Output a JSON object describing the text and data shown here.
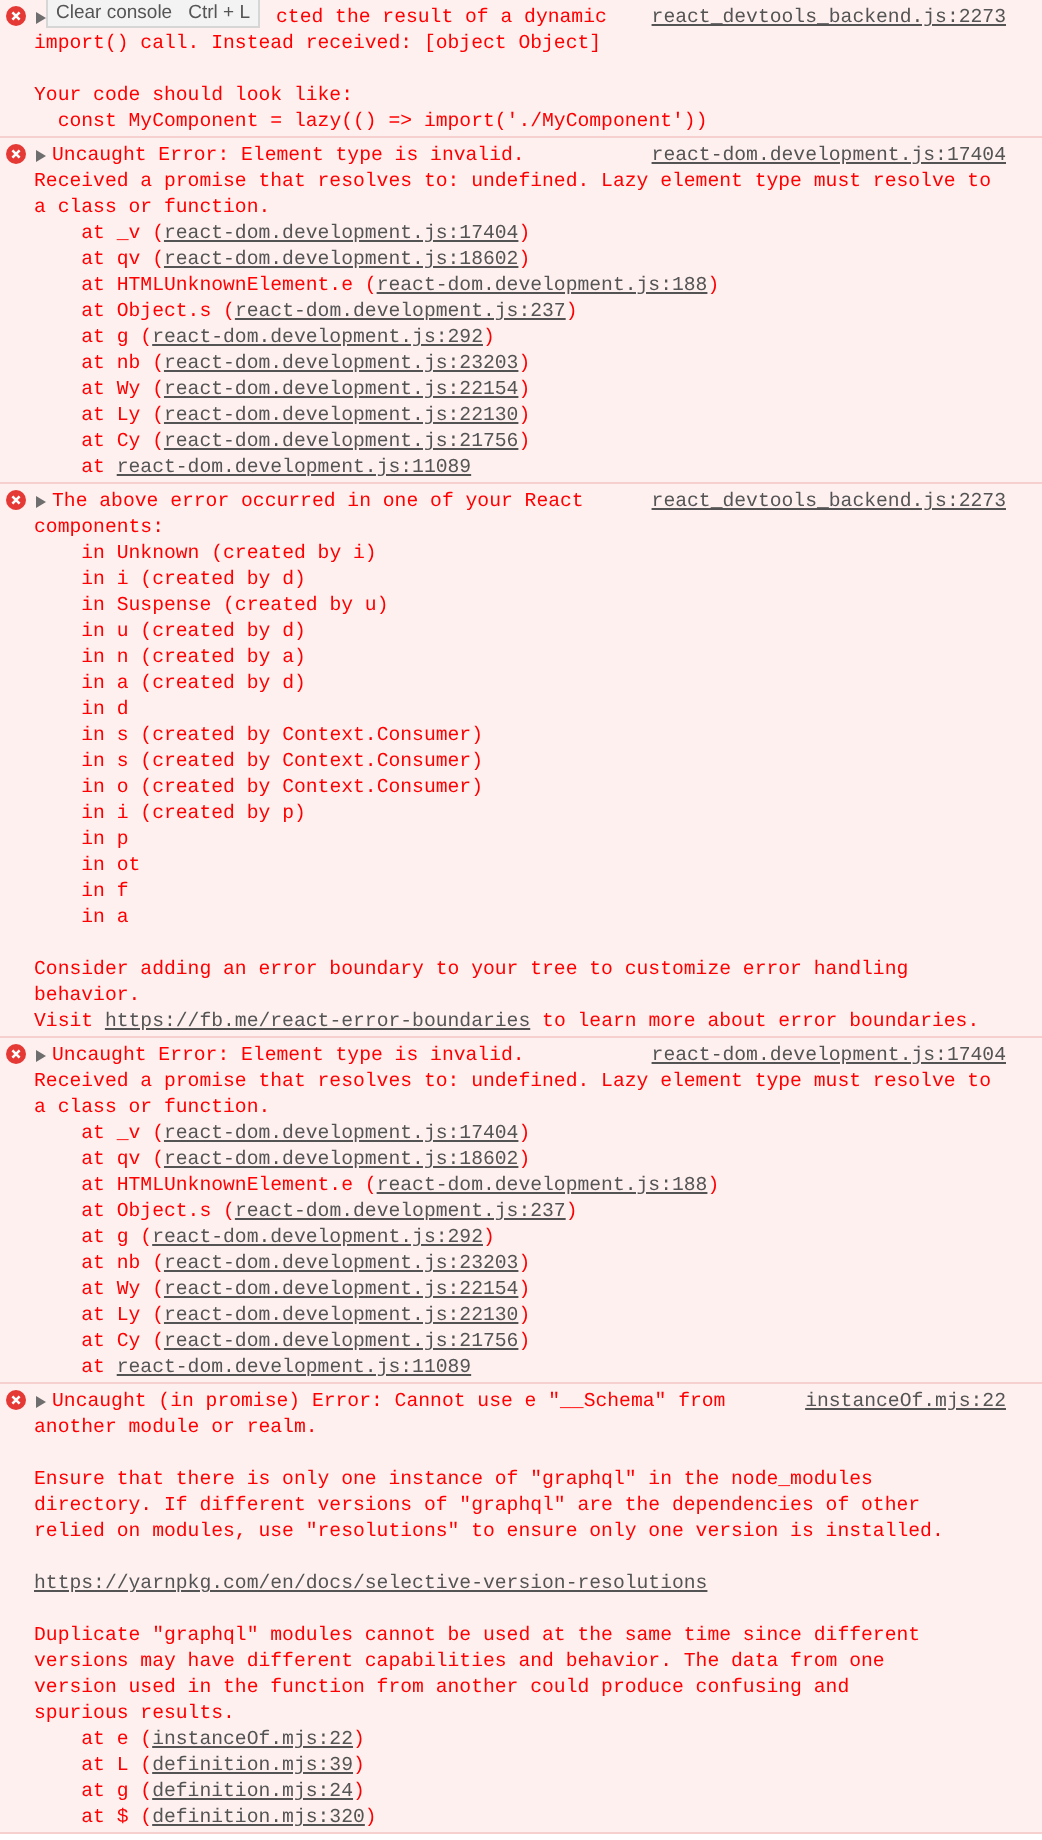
{
  "tooltip": {
    "label": "Clear console",
    "shortcut": "Ctrl + L"
  },
  "messages": [
    {
      "expanded": false,
      "header": "cted the result of a dynamic",
      "source": "react_devtools_backend.js:2273",
      "blocks": [
        {
          "kind": "text",
          "text": "import() call. Instead received: [object Object]\n\nYour code should look like:\n  const MyComponent = lazy(() => import('./MyComponent'))"
        }
      ]
    },
    {
      "expanded": false,
      "header": "Uncaught Error: Element type is invalid.",
      "source": "react-dom.development.js:17404",
      "blocks": [
        {
          "kind": "text",
          "text": "Received a promise that resolves to: undefined. Lazy element type must resolve to a class or function."
        },
        {
          "kind": "frame",
          "before": "    at _v (",
          "link": "react-dom.development.js:17404",
          "after": ")"
        },
        {
          "kind": "frame",
          "before": "    at qv (",
          "link": "react-dom.development.js:18602",
          "after": ")"
        },
        {
          "kind": "frame",
          "before": "    at HTMLUnknownElement.e (",
          "link": "react-dom.development.js:188",
          "after": ")"
        },
        {
          "kind": "frame",
          "before": "    at Object.s (",
          "link": "react-dom.development.js:237",
          "after": ")"
        },
        {
          "kind": "frame",
          "before": "    at g (",
          "link": "react-dom.development.js:292",
          "after": ")"
        },
        {
          "kind": "frame",
          "before": "    at nb (",
          "link": "react-dom.development.js:23203",
          "after": ")"
        },
        {
          "kind": "frame",
          "before": "    at Wy (",
          "link": "react-dom.development.js:22154",
          "after": ")"
        },
        {
          "kind": "frame",
          "before": "    at Ly (",
          "link": "react-dom.development.js:22130",
          "after": ")"
        },
        {
          "kind": "frame",
          "before": "    at Cy (",
          "link": "react-dom.development.js:21756",
          "after": ")"
        },
        {
          "kind": "frame",
          "before": "    at ",
          "link": "react-dom.development.js:11089"
        }
      ]
    },
    {
      "expanded": false,
      "header": "The above error occurred in one of your React",
      "source": "react_devtools_backend.js:2273",
      "blocks": [
        {
          "kind": "text",
          "text": "components:\n    in Unknown (created by i)\n    in i (created by d)\n    in Suspense (created by u)\n    in u (created by d)\n    in n (created by a)\n    in a (created by d)\n    in d\n    in s (created by Context.Consumer)\n    in s (created by Context.Consumer)\n    in o (created by Context.Consumer)\n    in i (created by p)\n    in p\n    in ot\n    in f\n    in a\n\nConsider adding an error boundary to your tree to customize error handling behavior."
        },
        {
          "kind": "linktext",
          "before": "Visit ",
          "link": "https://fb.me/react-error-boundaries",
          "after": " to learn more about error boundaries."
        }
      ]
    },
    {
      "expanded": false,
      "header": "Uncaught Error: Element type is invalid.",
      "source": "react-dom.development.js:17404",
      "blocks": [
        {
          "kind": "text",
          "text": "Received a promise that resolves to: undefined. Lazy element type must resolve to a class or function."
        },
        {
          "kind": "frame",
          "before": "    at _v (",
          "link": "react-dom.development.js:17404",
          "after": ")"
        },
        {
          "kind": "frame",
          "before": "    at qv (",
          "link": "react-dom.development.js:18602",
          "after": ")"
        },
        {
          "kind": "frame",
          "before": "    at HTMLUnknownElement.e (",
          "link": "react-dom.development.js:188",
          "after": ")"
        },
        {
          "kind": "frame",
          "before": "    at Object.s (",
          "link": "react-dom.development.js:237",
          "after": ")"
        },
        {
          "kind": "frame",
          "before": "    at g (",
          "link": "react-dom.development.js:292",
          "after": ")"
        },
        {
          "kind": "frame",
          "before": "    at nb (",
          "link": "react-dom.development.js:23203",
          "after": ")"
        },
        {
          "kind": "frame",
          "before": "    at Wy (",
          "link": "react-dom.development.js:22154",
          "after": ")"
        },
        {
          "kind": "frame",
          "before": "    at Ly (",
          "link": "react-dom.development.js:22130",
          "after": ")"
        },
        {
          "kind": "frame",
          "before": "    at Cy (",
          "link": "react-dom.development.js:21756",
          "after": ")"
        },
        {
          "kind": "frame",
          "before": "    at ",
          "link": "react-dom.development.js:11089"
        }
      ]
    },
    {
      "expanded": false,
      "header": "Uncaught (in promise) Error: Cannot use e \"__Schema\" from",
      "source": "instanceOf.mjs:22",
      "blocks": [
        {
          "kind": "text",
          "text": "another module or realm.\n\nEnsure that there is only one instance of \"graphql\" in the node_modules\ndirectory. If different versions of \"graphql\" are the dependencies of other\nrelied on modules, use \"resolutions\" to ensure only one version is installed."
        },
        {
          "kind": "url",
          "link": "https://yarnpkg.com/en/docs/selective-version-resolutions"
        },
        {
          "kind": "text",
          "text": "Duplicate \"graphql\" modules cannot be used at the same time since different\nversions may have different capabilities and behavior. The data from one\nversion used in the function from another could produce confusing and\nspurious results."
        },
        {
          "kind": "frame",
          "before": "    at e (",
          "link": "instanceOf.mjs:22",
          "after": ")"
        },
        {
          "kind": "frame",
          "before": "    at L (",
          "link": "definition.mjs:39",
          "after": ")"
        },
        {
          "kind": "frame",
          "before": "    at g (",
          "link": "definition.mjs:24",
          "after": ")"
        },
        {
          "kind": "frame",
          "before": "    at $ (",
          "link": "definition.mjs:320",
          "after": ")"
        }
      ]
    }
  ]
}
